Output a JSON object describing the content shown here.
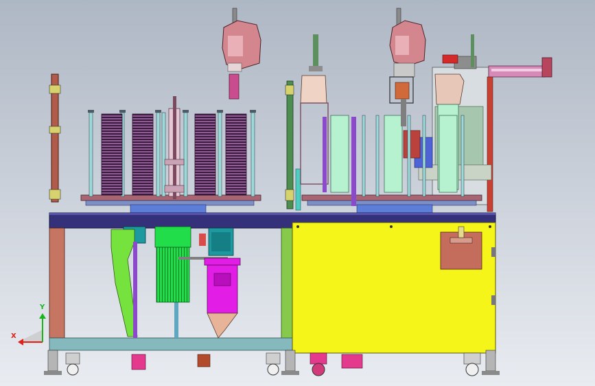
{
  "viewport": {
    "background_top": "#aeb7c4",
    "background_bottom": "#e9ecf1"
  },
  "triad": {
    "x_label": "X",
    "y_label": "Y",
    "x_color": "#e0211b",
    "y_color": "#19b31c"
  },
  "colors": {
    "frame_navy": "#34317a",
    "yellow_cabinet": "#f6f51a",
    "motor_green": "#22dd4a",
    "tank_magenta": "#e21ee6",
    "gearbox_teal": "#1c9aa0",
    "bracket_lime": "#76e23d",
    "lower_frame_teal": "#86b9bd",
    "leg_salmon": "#c57561",
    "coil_purple": "#6b2e6e",
    "robot_pink": "#d4868e",
    "panel_brown": "#c56d5c",
    "mint_column": "#b6f2cf",
    "grey_bar": "#8d8d8d"
  }
}
